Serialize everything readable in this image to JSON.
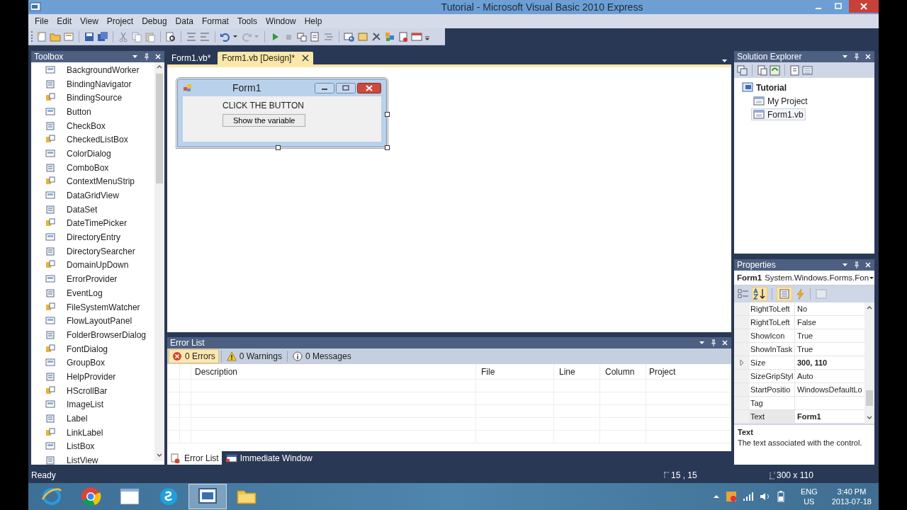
{
  "window": {
    "title": "Tutorial - Microsoft Visual Basic 2010 Express"
  },
  "menu": [
    "File",
    "Edit",
    "View",
    "Project",
    "Debug",
    "Data",
    "Format",
    "Tools",
    "Window",
    "Help"
  ],
  "toolbox": {
    "title": "Toolbox",
    "items": [
      "BackgroundWorker",
      "BindingNavigator",
      "BindingSource",
      "Button",
      "CheckBox",
      "CheckedListBox",
      "ColorDialog",
      "ComboBox",
      "ContextMenuStrip",
      "DataGridView",
      "DataSet",
      "DateTimePicker",
      "DirectoryEntry",
      "DirectorySearcher",
      "DomainUpDown",
      "ErrorProvider",
      "EventLog",
      "FileSystemWatcher",
      "FlowLayoutPanel",
      "FolderBrowserDialog",
      "FontDialog",
      "GroupBox",
      "HelpProvider",
      "HScrollBar",
      "ImageList",
      "Label",
      "LinkLabel",
      "ListBox",
      "ListView"
    ]
  },
  "doc_tabs": [
    {
      "label": "Form1.vb*",
      "selected": false
    },
    {
      "label": "Form1.vb [Design]*",
      "selected": true
    }
  ],
  "designer": {
    "form": {
      "title": "Form1",
      "label": "CLICK THE BUTTON",
      "button": "Show the variable"
    }
  },
  "error_list": {
    "title": "Error List",
    "filters": [
      {
        "kind": "error",
        "label": "0 Errors",
        "selected": true
      },
      {
        "kind": "warning",
        "label": "0 Warnings",
        "selected": false
      },
      {
        "kind": "info",
        "label": "0 Messages",
        "selected": false
      }
    ],
    "columns": [
      "Description",
      "File",
      "Line",
      "Column",
      "Project"
    ]
  },
  "bottom_tabs": [
    {
      "kind": "errors",
      "label": "Error List",
      "selected": true
    },
    {
      "kind": "immediate",
      "label": "Immediate Window",
      "selected": false
    }
  ],
  "solution_explorer": {
    "title": "Solution Explorer",
    "tree": [
      {
        "label": "Tutorial",
        "selected": false,
        "children": [
          {
            "label": "My Project",
            "selected": false
          },
          {
            "label": "Form1.vb",
            "selected": true
          }
        ]
      }
    ]
  },
  "properties": {
    "title": "Properties",
    "object_name": "Form1",
    "object_type": "System.Windows.Forms.Fon",
    "rows": [
      {
        "name": "RightToLeft",
        "value": "No",
        "modified": false,
        "expandable": false,
        "selected": false
      },
      {
        "name": "RightToLeft",
        "value": "False",
        "modified": false,
        "expandable": false,
        "selected": false
      },
      {
        "name": "ShowIcon",
        "value": "True",
        "modified": false,
        "expandable": false,
        "selected": false
      },
      {
        "name": "ShowInTask",
        "value": "True",
        "modified": false,
        "expandable": false,
        "selected": false
      },
      {
        "name": "Size",
        "value": "300, 110",
        "modified": true,
        "expandable": true,
        "selected": false
      },
      {
        "name": "SizeGripStyl",
        "value": "Auto",
        "modified": false,
        "expandable": false,
        "selected": false
      },
      {
        "name": "StartPositio",
        "value": "WindowsDefaultLo",
        "modified": false,
        "expandable": false,
        "selected": false
      },
      {
        "name": "Tag",
        "value": "",
        "expandable": false,
        "selected": false
      },
      {
        "name": "Text",
        "value": "Form1",
        "modified": true,
        "expandable": false,
        "selected": true
      }
    ],
    "description": {
      "title": "Text",
      "text": "The text associated with the control."
    }
  },
  "status_bar": {
    "text": "Ready",
    "position": "15 , 15",
    "size": "300 x 110"
  },
  "taskbar": {
    "apps": [
      {
        "kind": "ie",
        "selected": false
      },
      {
        "kind": "chrome",
        "selected": false
      },
      {
        "kind": "window",
        "selected": false
      },
      {
        "kind": "skype",
        "selected": false
      },
      {
        "kind": "vb",
        "selected": true
      },
      {
        "kind": "folder",
        "selected": false
      }
    ],
    "language": "ENG",
    "region": "US",
    "time": "3:40 PM",
    "date": "2013-07-18"
  }
}
